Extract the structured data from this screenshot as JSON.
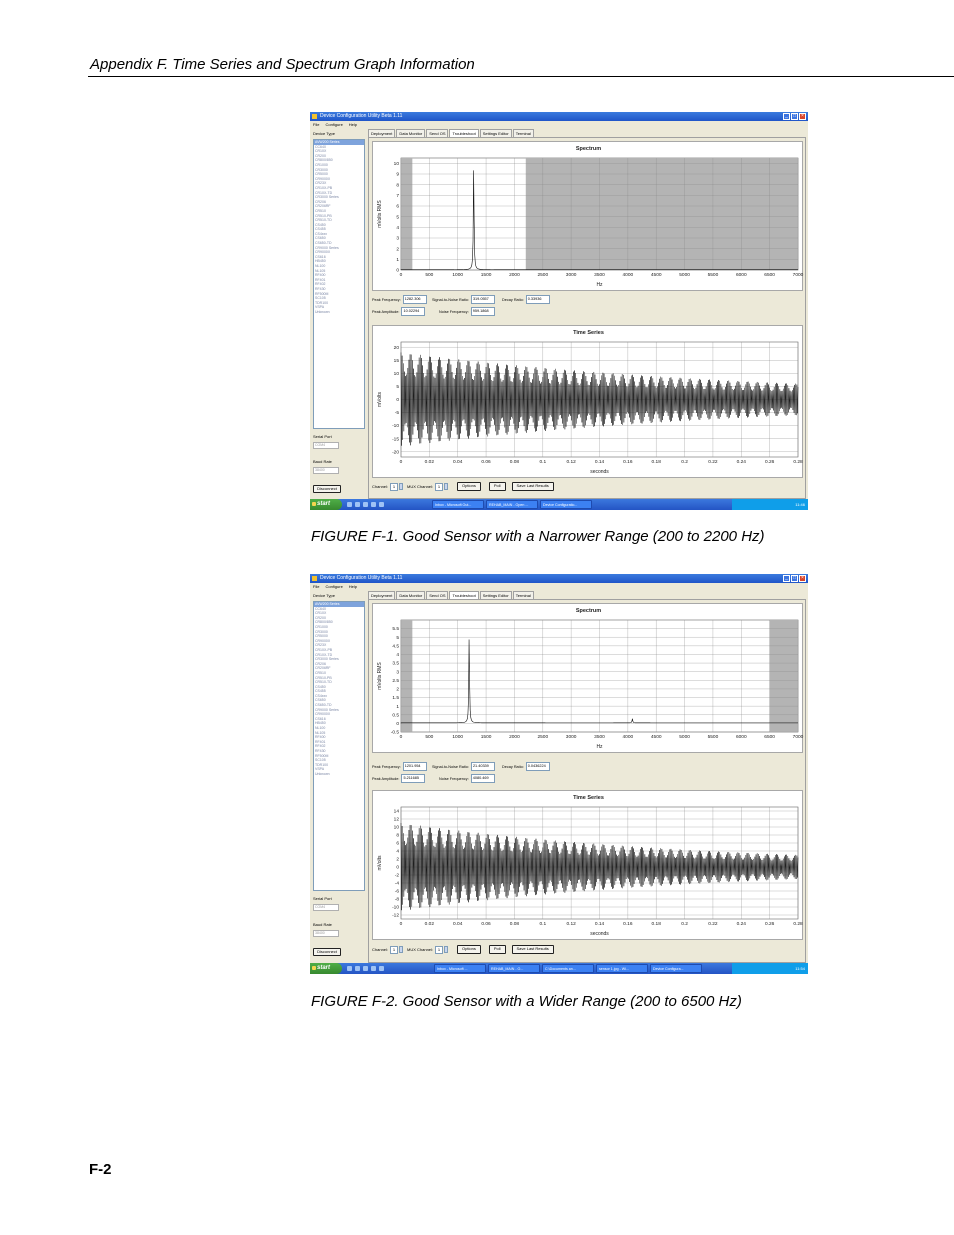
{
  "page": {
    "header": "Appendix F.  Time Series and Spectrum Graph Information",
    "page_number": "F-2"
  },
  "figures": [
    {
      "caption": "FIGURE F-1.  Good Sensor with a Narrower Range (200 to 2200 Hz)",
      "window": {
        "title": "Device Configuration Utility Beta 1.11",
        "menu": [
          "File",
          "Configure",
          "Help"
        ],
        "device_type_label": "Device Type",
        "device_list": [
          "AVW200 Series",
          "CC640",
          "CR10X",
          "CR200",
          "CR800/850",
          "CR1000",
          "CR3000",
          "CR5000",
          "CR9000X",
          "CR23X",
          "CR10X-PB",
          "CR10X-TD",
          "CR3000 Series",
          "CR206",
          "CR206RF",
          "CR510",
          "CR510-PB",
          "CR510-TD",
          "CS450",
          "CS455",
          "CS4xxx",
          "CS650",
          "CS650-TD",
          "CR9000 Series",
          "CR9000X",
          "CS616",
          "HB450",
          "NL100",
          "NL105",
          "RF400",
          "RF401",
          "RF402",
          "RF430",
          "RF500M",
          "SC105",
          "TDR100",
          "VSPA",
          "Unknown"
        ],
        "selected_device": "AVW200 Series",
        "serial_port_label": "Serial Port",
        "serial_port_value": "COM4",
        "baud_rate_label": "Baud Rate",
        "baud_rate_value": "38400",
        "disconnect_label": "Disconnect",
        "tabs": [
          "Deployment",
          "Data Monitor",
          "Send OS",
          "Troubleshoot",
          "Settings Editor",
          "Terminal"
        ],
        "active_tab": "Troubleshoot",
        "readouts": {
          "peak_frequency_label": "Peak Frequency:",
          "peak_frequency": "1282.306",
          "snr_label": "Signal-to-Noise Ratio:",
          "snr": "319.0557",
          "decay_label": "Decay Ratio:",
          "decay": "0.33936",
          "peak_amplitude_label": "Peak Amplitude:",
          "peak_amplitude": "10.02294",
          "noise_frequency_label": "Noise Frequency:",
          "noise_frequency": "959.1868"
        },
        "controls": {
          "channel_label": "Channel:",
          "channel_value": "1",
          "mux_label": "MUX Channel:",
          "mux_value": "1",
          "options_label": "Options",
          "poll_label": "Poll",
          "save_label": "Save Last Results"
        },
        "taskbar": {
          "start_label": "start",
          "items": [
            "Inbox - Microsoft Out...",
            "REHAB_MAIN - Open ...",
            "Device Configuratio..."
          ],
          "clock": "11:46"
        }
      },
      "chart_data": [
        {
          "type": "line",
          "title": "Spectrum",
          "xlabel": "Hz",
          "ylabel": "mVolts RMS",
          "xlim": [
            0,
            7000
          ],
          "ylim": [
            0,
            10.5
          ],
          "xticks": [
            0,
            500,
            1000,
            1500,
            2000,
            2500,
            3000,
            3500,
            4000,
            4500,
            5000,
            5500,
            6000,
            6500,
            7000
          ],
          "yticks": [
            0,
            1,
            2,
            3,
            4,
            5,
            6,
            7,
            8,
            9,
            10
          ],
          "shaded_regions": [
            [
              0,
              200
            ],
            [
              2200,
              7000
            ]
          ],
          "peaks": [
            {
              "x": 1282,
              "y": 10.02
            }
          ],
          "grid": true
        },
        {
          "type": "line",
          "title": "Time Series",
          "xlabel": "seconds",
          "ylabel": "mVolts",
          "xlim": [
            0,
            0.28
          ],
          "ylim": [
            -22,
            22
          ],
          "xticks": [
            0,
            0.02,
            0.04,
            0.06,
            0.08,
            0.1,
            0.12,
            0.14,
            0.16,
            0.18,
            0.2,
            0.22,
            0.24,
            0.26,
            0.28
          ],
          "yticks": [
            20,
            15,
            10,
            5,
            0,
            -5,
            -10,
            -15,
            -20
          ],
          "start_amplitude": 18,
          "end_amplitude": 6,
          "grid": true
        }
      ]
    },
    {
      "caption": "FIGURE F-2.  Good Sensor with a Wider Range (200 to 6500 Hz)",
      "window": {
        "title": "Device Configuration Utility Beta 1.11",
        "menu": [
          "File",
          "Configure",
          "Help"
        ],
        "device_type_label": "Device Type",
        "device_list": [
          "AVW200 Series",
          "CC640",
          "CR10X",
          "CR200",
          "CR800/850",
          "CR1000",
          "CR3000",
          "CR5000",
          "CR9000X",
          "CR23X",
          "CR10X-PB",
          "CR10X-TD",
          "CR3000 Series",
          "CR206",
          "CR206RF",
          "CR510",
          "CR510-PB",
          "CR510-TD",
          "CS450",
          "CS455",
          "CS4xxx",
          "CS650",
          "CS650-TD",
          "CR9000 Series",
          "CR9000X",
          "CS616",
          "HB450",
          "NL100",
          "NL105",
          "RF400",
          "RF401",
          "RF402",
          "RF430",
          "RF500M",
          "SC105",
          "TDR100",
          "VSPA",
          "Unknown"
        ],
        "selected_device": "AVW200 Series",
        "serial_port_label": "Serial Port",
        "serial_port_value": "COM4",
        "baud_rate_label": "Baud Rate",
        "baud_rate_value": "38400",
        "disconnect_label": "Disconnect",
        "tabs": [
          "Deployment",
          "Data Monitor",
          "Send OS",
          "Troubleshoot",
          "Settings Editor",
          "Terminal"
        ],
        "active_tab": "Troubleshoot",
        "readouts": {
          "peak_frequency_label": "Peak Frequency:",
          "peak_frequency": "1201.954",
          "snr_label": "Signal-to-Noise Ratio:",
          "snr": "21.40339",
          "decay_label": "Decay Ratio:",
          "decay": "0.0436224",
          "peak_amplitude_label": "Peak Amplitude:",
          "peak_amplitude": "5.211685",
          "noise_frequency_label": "Noise Frequency:",
          "noise_frequency": "4080.469"
        },
        "controls": {
          "channel_label": "Channel:",
          "channel_value": "1",
          "mux_label": "MUX Channel:",
          "mux_value": "1",
          "options_label": "Options",
          "poll_label": "Poll",
          "save_label": "Save Last Results"
        },
        "taskbar": {
          "start_label": "start",
          "items": [
            "Inbox - Microsoft ...",
            "REHAB_MAIN - O...",
            "C:\\Documents an...",
            "sensor 1.jpg - Wi...",
            "Device Configura..."
          ],
          "clock": "11:54"
        }
      },
      "chart_data": [
        {
          "type": "line",
          "title": "Spectrum",
          "xlabel": "Hz",
          "ylabel": "mVolts RMS",
          "xlim": [
            0,
            7000
          ],
          "ylim": [
            -0.5,
            6
          ],
          "xticks": [
            0,
            500,
            1000,
            1500,
            2000,
            2500,
            3000,
            3500,
            4000,
            4500,
            5000,
            5500,
            6000,
            6500,
            7000
          ],
          "yticks": [
            5.5,
            5,
            4.5,
            4,
            3.5,
            3,
            2.5,
            2,
            1.5,
            1,
            0.5,
            0,
            -0.5
          ],
          "shaded_regions": [
            [
              0,
              200
            ],
            [
              6500,
              7000
            ]
          ],
          "peaks": [
            {
              "x": 1202,
              "y": 5.21
            },
            {
              "x": 4080,
              "y": 0.24
            }
          ],
          "grid": true
        },
        {
          "type": "line",
          "title": "Time Series",
          "xlabel": "seconds",
          "ylabel": "mVolts",
          "xlim": [
            0,
            0.28
          ],
          "ylim": [
            -13,
            15
          ],
          "xticks": [
            0,
            0.02,
            0.04,
            0.06,
            0.08,
            0.1,
            0.12,
            0.14,
            0.16,
            0.18,
            0.2,
            0.22,
            0.24,
            0.26,
            0.28
          ],
          "yticks": [
            14,
            12,
            10,
            8,
            6,
            4,
            2,
            0,
            -2,
            -4,
            -6,
            -8,
            -10,
            -12
          ],
          "start_amplitude": 11,
          "end_amplitude": 3,
          "grid": true
        }
      ]
    }
  ]
}
